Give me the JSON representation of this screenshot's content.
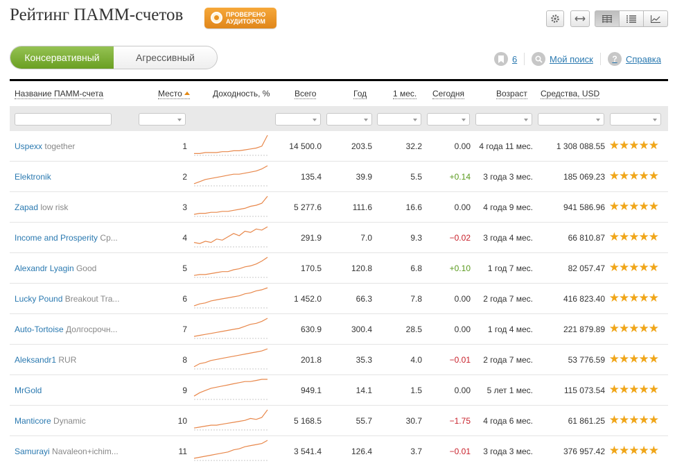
{
  "page": {
    "title": "Рейтинг ПАММ-счетов",
    "badge": [
      "ПРОВЕРЕНО",
      "АУДИТОРОМ"
    ]
  },
  "toolbar": {
    "icons": [
      "gear-icon",
      "arrows-horizontal-icon",
      "grid-view-icon",
      "list-view-icon",
      "chart-view-icon"
    ]
  },
  "tabs": [
    "Консервативный",
    "Агрессивный"
  ],
  "tabs_active": 0,
  "links": {
    "bookmarks_count": "6",
    "my_search": "Мой поиск",
    "help": "Справка",
    "help_icon": "?"
  },
  "table": {
    "columns": {
      "name": "Название ПАММ-счета",
      "place": "Место",
      "yield": "Доходность, %",
      "total": "Всего",
      "year": "Год",
      "month": "1 мес.",
      "today": "Сегодня",
      "age": "Возраст",
      "funds": "Средства, USD"
    },
    "rows": [
      {
        "name": "Uspexx",
        "sub": "together",
        "place": "1",
        "total": "14 500.0",
        "year": "203.5",
        "month": "32.2",
        "today": "0.00",
        "today_sign": "zero",
        "age": "4 года 11 мес.",
        "funds": "1 308 088.55",
        "stars": "★★★★★",
        "spark": [
          2,
          2,
          3,
          3,
          3,
          4,
          4,
          5,
          5,
          6,
          7,
          8,
          10,
          22
        ]
      },
      {
        "name": "Elektronik",
        "sub": "",
        "place": "2",
        "total": "135.4",
        "year": "39.9",
        "month": "5.5",
        "today": "+0.14",
        "today_sign": "pos",
        "age": "3 года 3 мес.",
        "funds": "185 069.23",
        "stars": "★★★★★",
        "spark": [
          2,
          4,
          6,
          7,
          8,
          9,
          10,
          11,
          11,
          12,
          13,
          14,
          16,
          19
        ]
      },
      {
        "name": "Zapad",
        "sub": "low risk",
        "place": "3",
        "total": "5 277.6",
        "year": "111.6",
        "month": "16.6",
        "today": "0.00",
        "today_sign": "zero",
        "age": "4 года 9 мес.",
        "funds": "941 586.96",
        "stars": "★★★★★",
        "spark": [
          2,
          3,
          3,
          4,
          4,
          5,
          5,
          6,
          7,
          8,
          10,
          11,
          13,
          20
        ]
      },
      {
        "name": "Income and Prosperity",
        "sub": "Cp...",
        "place": "4",
        "total": "291.9",
        "year": "7.0",
        "month": "9.3",
        "today": "−0.02",
        "today_sign": "neg",
        "age": "3 года 4 мес.",
        "funds": "66 810.87",
        "stars": "★★★★★",
        "spark": [
          4,
          3,
          5,
          4,
          7,
          6,
          9,
          12,
          10,
          14,
          13,
          16,
          15,
          18
        ]
      },
      {
        "name": "Alexandr Lyagin",
        "sub": "Good",
        "place": "5",
        "total": "170.5",
        "year": "120.8",
        "month": "6.8",
        "today": "+0.10",
        "today_sign": "pos",
        "age": "1 год 7 мес.",
        "funds": "82 057.47",
        "stars": "★★★★★",
        "spark": [
          2,
          3,
          3,
          4,
          5,
          6,
          6,
          8,
          9,
          11,
          12,
          14,
          17,
          21
        ]
      },
      {
        "name": "Lucky Pound",
        "sub": "Breakout Tra...",
        "place": "6",
        "total": "1 452.0",
        "year": "66.3",
        "month": "7.8",
        "today": "0.00",
        "today_sign": "zero",
        "age": "2 года 7 мес.",
        "funds": "416 823.40",
        "stars": "★★★★★",
        "spark": [
          2,
          4,
          5,
          7,
          8,
          9,
          10,
          11,
          12,
          14,
          15,
          17,
          18,
          20
        ]
      },
      {
        "name": "Auto-Tortoise",
        "sub": "Долгосрочн...",
        "place": "7",
        "total": "630.9",
        "year": "300.4",
        "month": "28.5",
        "today": "0.00",
        "today_sign": "zero",
        "age": "1 год 4 мес.",
        "funds": "221 879.89",
        "stars": "★★★★★",
        "spark": [
          2,
          3,
          4,
          5,
          6,
          7,
          8,
          9,
          10,
          12,
          14,
          15,
          17,
          20
        ]
      },
      {
        "name": "Aleksandr1",
        "sub": "RUR",
        "place": "8",
        "total": "201.8",
        "year": "35.3",
        "month": "4.0",
        "today": "−0.01",
        "today_sign": "neg",
        "age": "2 года 7 мес.",
        "funds": "53 776.59",
        "stars": "★★★★★",
        "spark": [
          2,
          5,
          6,
          8,
          9,
          10,
          11,
          12,
          13,
          14,
          15,
          16,
          17,
          19
        ]
      },
      {
        "name": "MrGold",
        "sub": "",
        "place": "9",
        "total": "949.1",
        "year": "14.1",
        "month": "1.5",
        "today": "0.00",
        "today_sign": "zero",
        "age": "5 лет 1 мес.",
        "funds": "115 073.54",
        "stars": "★★★★★",
        "spark": [
          3,
          6,
          8,
          10,
          11,
          12,
          13,
          14,
          15,
          16,
          16,
          17,
          18,
          18
        ]
      },
      {
        "name": "Manticore",
        "sub": "Dynamic",
        "place": "10",
        "total": "5 168.5",
        "year": "55.7",
        "month": "30.7",
        "today": "−1.75",
        "today_sign": "neg",
        "age": "4 года 6 мес.",
        "funds": "61 861.25",
        "stars": "★★★★★",
        "spark": [
          2,
          3,
          4,
          5,
          5,
          6,
          7,
          8,
          9,
          10,
          12,
          11,
          13,
          21
        ]
      },
      {
        "name": "Samurayi",
        "sub": "Navaleon+ichim...",
        "place": "11",
        "total": "3 541.4",
        "year": "126.4",
        "month": "3.7",
        "today": "−0.01",
        "today_sign": "neg",
        "age": "3 года 3 мес.",
        "funds": "376 957.42",
        "stars": "★★★★★",
        "spark": [
          2,
          3,
          4,
          5,
          6,
          7,
          8,
          10,
          11,
          13,
          14,
          15,
          16,
          19
        ]
      }
    ]
  }
}
